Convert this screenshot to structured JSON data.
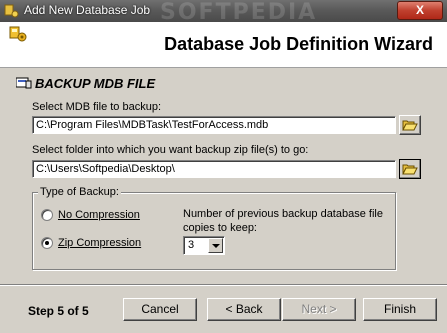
{
  "window": {
    "title": "Add New Database Job",
    "watermark": "SOFTPEDIA",
    "close_glyph": "X"
  },
  "header": {
    "wizard_title": "Database Job Definition Wizard"
  },
  "section": {
    "title": "BACKUP MDB FILE"
  },
  "mdb": {
    "label": "Select MDB file to backup:",
    "value": "C:\\Program Files\\MDBTask\\TestForAccess.mdb"
  },
  "folder": {
    "label": "Select folder into which you want backup zip file(s) to go:",
    "value": "C:\\Users\\Softpedia\\Desktop\\"
  },
  "backup_type": {
    "legend": "Type of Backup:",
    "options": [
      {
        "label": "No Compression",
        "selected": false
      },
      {
        "label": "Zip Compression",
        "selected": true
      }
    ],
    "copies_label_line1": "Number of previous backup database file",
    "copies_label_line2": "copies to keep:",
    "copies_value": "3"
  },
  "footer": {
    "step": "Step 5 of 5",
    "cancel": "Cancel",
    "back": "< Back",
    "next": "Next >",
    "finish": "Finish"
  },
  "icons": {
    "app": "wizard-keys-icon",
    "section": "database-icon",
    "browse": "open-folder-icon"
  }
}
